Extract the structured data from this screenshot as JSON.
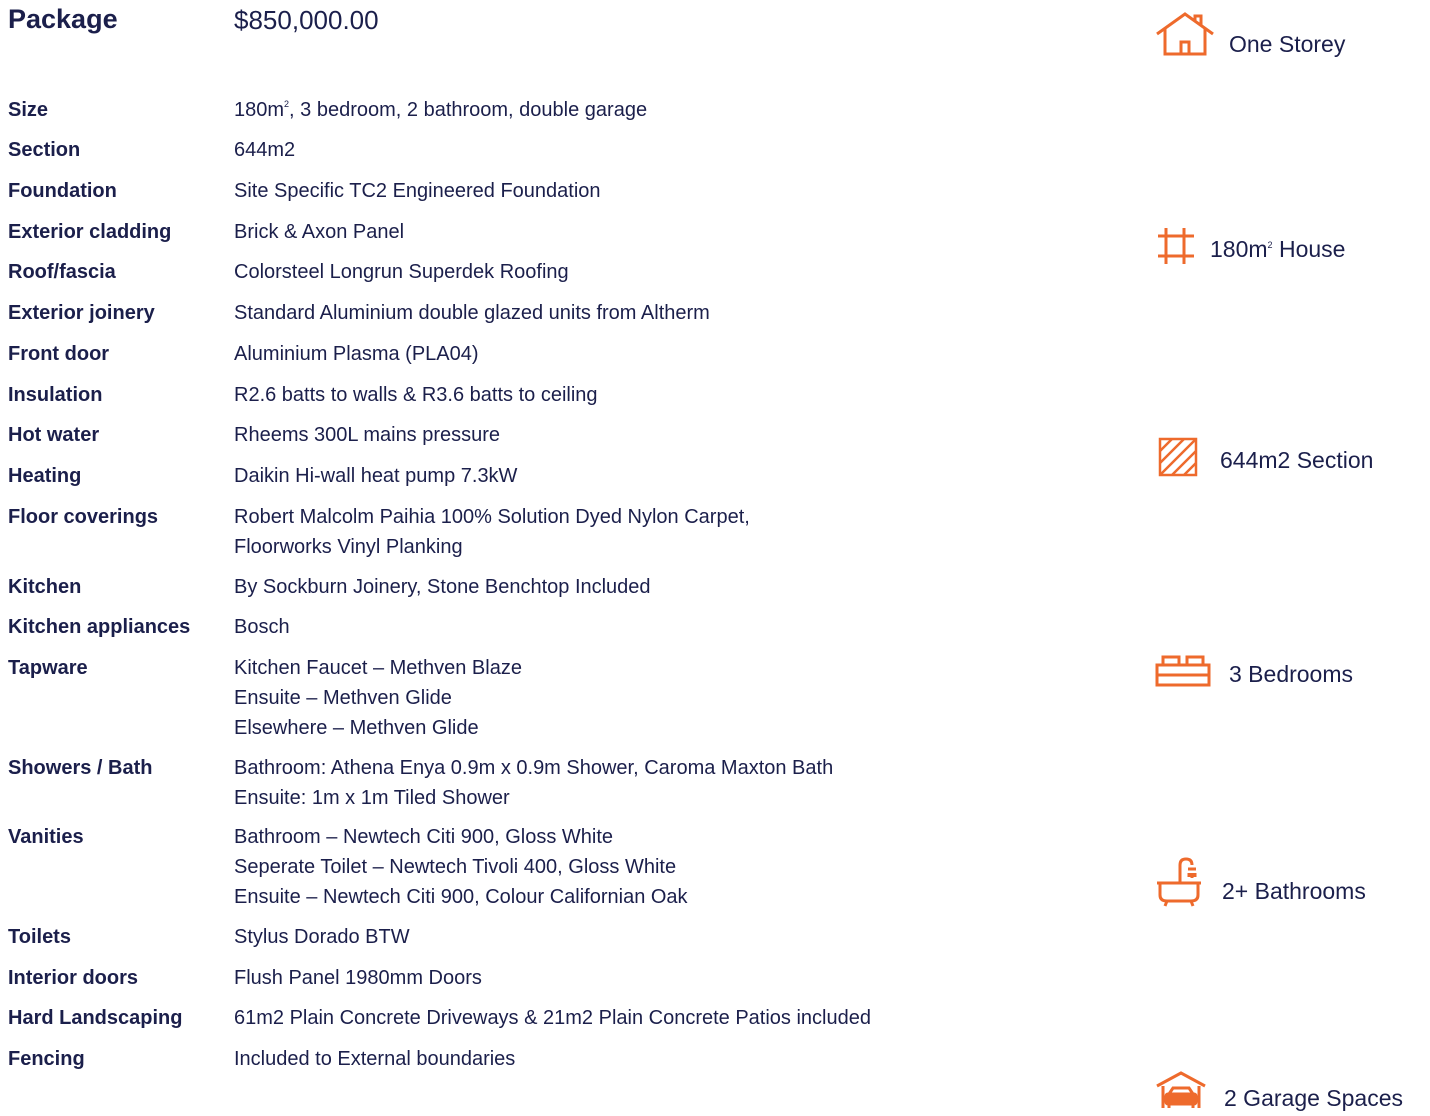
{
  "package": {
    "label": "Package",
    "price": "$850,000.00"
  },
  "accent_color": "#ee6a2c",
  "text_color": "#1b1f4b",
  "specs": [
    {
      "label": "Size",
      "value": [
        "180m², 3 bedroom, 2 bathroom, double garage"
      ]
    },
    {
      "label": "Section",
      "value": [
        "644m2"
      ]
    },
    {
      "label": "Foundation",
      "value": [
        "Site Specific TC2 Engineered Foundation"
      ]
    },
    {
      "label": "Exterior cladding",
      "value": [
        "Brick & Axon Panel"
      ]
    },
    {
      "label": "Roof/fascia",
      "value": [
        "Colorsteel Longrun Superdek Roofing"
      ]
    },
    {
      "label": "Exterior joinery",
      "value": [
        "Standard Aluminium double glazed units from Altherm"
      ]
    },
    {
      "label": "Front door",
      "value": [
        "Aluminium Plasma (PLA04)"
      ]
    },
    {
      "label": "Insulation",
      "value": [
        "R2.6 batts to walls & R3.6 batts to ceiling"
      ]
    },
    {
      "label": "Hot water",
      "value": [
        "Rheems 300L mains pressure"
      ]
    },
    {
      "label": "Heating",
      "value": [
        "Daikin Hi-wall heat pump 7.3kW"
      ]
    },
    {
      "label": "Floor coverings",
      "value": [
        "Robert Malcolm Paihia 100% Solution Dyed Nylon Carpet,",
        "Floorworks Vinyl Planking"
      ]
    },
    {
      "label": "Kitchen",
      "value": [
        "By Sockburn Joinery, Stone Benchtop Included"
      ]
    },
    {
      "label": "Kitchen appliances",
      "value": [
        "Bosch"
      ]
    },
    {
      "label": "Tapware",
      "value": [
        "Kitchen Faucet – Methven Blaze",
        "Ensuite – Methven Glide",
        "Elsewhere – Methven Glide"
      ]
    },
    {
      "label": "Showers / Bath",
      "value": [
        "Bathroom: Athena Enya 0.9m x 0.9m Shower, Caroma Maxton Bath",
        "Ensuite: 1m x 1m Tiled Shower"
      ]
    },
    {
      "label": "Vanities",
      "value": [
        "Bathroom – Newtech Citi 900, Gloss White",
        "Seperate Toilet – Newtech Tivoli 400, Gloss White",
        "Ensuite – Newtech Citi 900, Colour Californian Oak"
      ]
    },
    {
      "label": "Toilets",
      "value": [
        "Stylus Dorado BTW"
      ]
    },
    {
      "label": "Interior doors",
      "value": [
        "Flush Panel 1980mm Doors"
      ]
    },
    {
      "label": "Hard Landscaping",
      "value": [
        "61m2 Plain Concrete Driveways & 21m2 Plain Concrete Patios included"
      ]
    },
    {
      "label": "Fencing",
      "value": [
        "Included to External boundaries"
      ]
    }
  ],
  "features": [
    {
      "icon": "house-icon",
      "text": "One Storey"
    },
    {
      "icon": "floor-area-icon",
      "text": "180m² House"
    },
    {
      "icon": "section-hatch-icon",
      "text": "644m2 Section"
    },
    {
      "icon": "bed-icon",
      "text": "3 Bedrooms"
    },
    {
      "icon": "bath-icon",
      "text": "2+ Bathrooms"
    },
    {
      "icon": "garage-car-icon",
      "text": "2 Garage Spaces"
    }
  ]
}
